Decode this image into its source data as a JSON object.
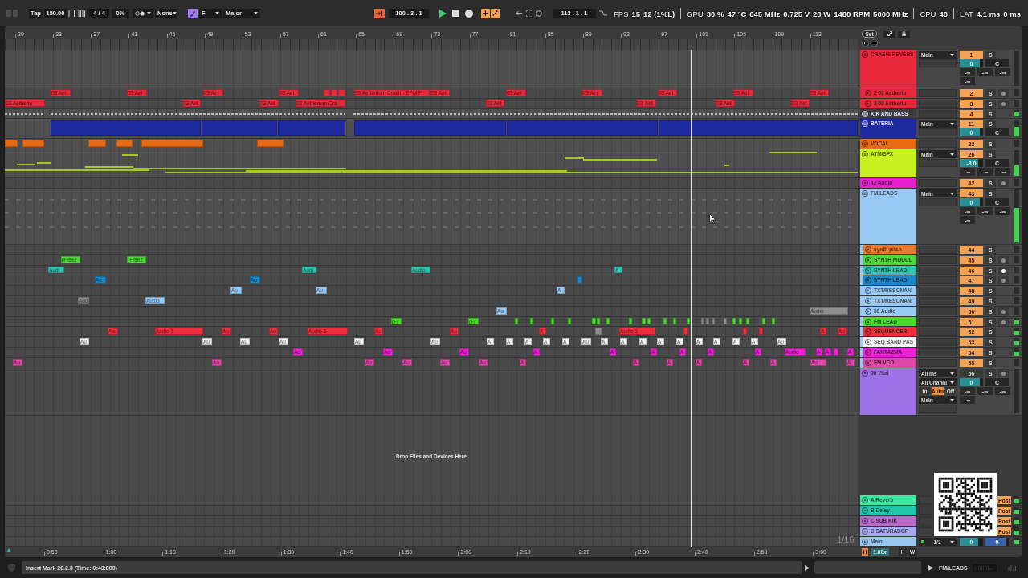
{
  "toolbar": {
    "tap": "Tap",
    "tempo": "150.00",
    "signature": "4 / 4",
    "groove": "0%",
    "quantize": "None",
    "scale_mode_on": true,
    "key": "F",
    "scale": "Major",
    "follow_on": true,
    "position": "100 . 3 . 1",
    "playing": true,
    "recording": false,
    "overdub_on": true,
    "automation_arm_on": true,
    "loop_length": "113 . 1 . 1"
  },
  "perf_overlay": [
    {
      "label": "FPS",
      "values": [
        "15",
        "12 (1%L)"
      ]
    },
    {
      "label": "GPU",
      "values": [
        "30 %",
        "47 °C",
        "645 MHz",
        "0.725 V",
        "28 W",
        "1480 RPM",
        "5000 MHz"
      ]
    },
    {
      "label": "CPU",
      "values": [
        "40"
      ]
    },
    {
      "label": "LAT",
      "values": [
        "4.1 ms",
        "0 ms"
      ]
    }
  ],
  "ruler": {
    "bars": [
      "29",
      "33",
      "37",
      "41",
      "45",
      "49",
      "53",
      "57",
      "61",
      "65",
      "69",
      "73",
      "77",
      "81",
      "85",
      "89",
      "93",
      "97",
      "101",
      "105",
      "109",
      "113"
    ],
    "set_button": "Set"
  },
  "tracks": [
    {
      "name": "CRASH/ REVERS",
      "kind": "group",
      "color": "#e8283c",
      "number": "1",
      "active": true,
      "solo": {
        "label": "S",
        "on": false
      },
      "io": "Main",
      "volume": {
        "value": "0",
        "level": 0.86
      },
      "pan": "C",
      "peaks": [
        "-∞",
        "-∞",
        "-∞",
        "-∞"
      ],
      "children": [
        {
          "name": "2 03 Aetheriu",
          "kind": "track",
          "expanded": false,
          "color": "#e8283c",
          "number": "2",
          "active": true,
          "solo": {
            "label": "S",
            "on": false
          },
          "arm": {
            "armed": false
          },
          "clips": [
            {
              "label": "03 Aet",
              "active": true
            },
            {
              "label": "03 Aet",
              "active": true
            },
            {
              "label": "03 Aet",
              "active": true
            },
            {
              "label": "03 Aet",
              "active": true
            },
            {
              "active": true
            },
            {
              "active": true
            },
            {
              "active": true
            },
            {
              "label": "03 Aetherium Crash - EPM F",
              "active": true
            },
            {
              "label": "03 Aet",
              "active": true
            },
            {
              "label": "03 Aet",
              "active": true
            },
            {
              "label": "03 Aet",
              "active": true
            },
            {
              "label": "03 Aet",
              "active": true
            },
            {
              "label": "03 Aet",
              "active": true
            },
            {
              "label": "03 Aet",
              "active": true
            }
          ]
        },
        {
          "name": "3 03 Aetheriu",
          "kind": "track",
          "expanded": false,
          "color": "#e8283c",
          "number": "3",
          "active": true,
          "solo": {
            "label": "S",
            "on": false
          },
          "arm": {
            "armed": false
          },
          "clips": [
            {
              "label": "03 Aetheriu",
              "active": true
            },
            {
              "label": "03 Aet",
              "active": true
            },
            {
              "label": "03 Aet",
              "active": true
            },
            {
              "label": "03 Aetherium Cra",
              "active": true
            },
            {
              "label": "03 Aet",
              "active": true
            },
            {
              "label": "03 Aet",
              "active": true
            },
            {
              "label": "03 Aet",
              "active": true
            },
            {
              "label": "03 Aet",
              "active": true
            }
          ]
        }
      ]
    },
    {
      "name": "KIK AND BASS",
      "kind": "group",
      "color": "#3d3d3d",
      "number": "4",
      "active": true,
      "solo": {
        "label": "S",
        "on": false
      },
      "signal": true
    },
    {
      "name": "BATERIA",
      "kind": "group",
      "color": "#1f2aa0",
      "number": "11",
      "active": true,
      "solo": {
        "label": "S",
        "on": false
      },
      "io": "Main",
      "volume": {
        "value": "0",
        "level": 0.86
      },
      "pan": "C",
      "meter": {
        "level": 0.55
      },
      "clips": [
        {
          "active": true
        },
        {
          "active": true
        },
        {
          "active": true
        },
        {
          "active": true
        },
        {
          "active": true
        },
        {
          "active": true
        }
      ]
    },
    {
      "name": "VOCAL",
      "kind": "group",
      "color": "#e86a14",
      "number": "23",
      "active": true,
      "solo": {
        "label": "S",
        "on": false
      },
      "clips": [
        {
          "active": true
        },
        {
          "active": true
        },
        {
          "active": true
        },
        {
          "active": true
        },
        {
          "active": true
        },
        {
          "active": true
        }
      ]
    },
    {
      "name": "ATM/SFX",
      "kind": "group",
      "color": "#c6f01e",
      "number": "26",
      "active": true,
      "solo": {
        "label": "S",
        "on": false
      },
      "io": "Main",
      "volume": {
        "value": "-3.0",
        "level": 0.8
      },
      "pan": "C",
      "peaks": [
        "-∞",
        "-∞",
        "-∞"
      ],
      "meter": {
        "level": 0.4
      }
    },
    {
      "name": "42 Audio",
      "kind": "track",
      "expanded": false,
      "color": "#e620cc",
      "number": "42",
      "active": true,
      "solo": {
        "label": "S",
        "on": false
      },
      "arm": {
        "armed": false
      }
    },
    {
      "name": "FM/LEADS",
      "kind": "group",
      "color": "#98c8f4",
      "number": "43",
      "active": true,
      "solo": {
        "label": "S",
        "on": false
      },
      "io": "Main",
      "volume": {
        "value": "0",
        "level": 0.86
      },
      "pan": "C",
      "peaks": [
        "-∞",
        "-∞",
        "-∞",
        "-∞"
      ],
      "meter": {
        "level": 0.65
      },
      "children": [
        {
          "name": "synth pitch",
          "kind": "track",
          "expanded": false,
          "color": "#ec7a2e",
          "number": "44",
          "active": true,
          "solo": {
            "label": "S",
            "on": false
          }
        },
        {
          "name": "SYNTH MODUL",
          "kind": "track",
          "expanded": false,
          "color": "#4ed63a",
          "number": "45",
          "active": true,
          "solo": {
            "label": "S",
            "on": false
          },
          "arm": {
            "armed": false
          },
          "clips": [
            {
              "label": "(Freez",
              "active": true
            },
            {
              "label": "(Freez",
              "active": true
            }
          ]
        },
        {
          "name": "SYNTH LEAD",
          "kind": "track",
          "expanded": false,
          "color": "#2cc6ae",
          "number": "46",
          "active": true,
          "solo": {
            "label": "S",
            "on": false
          },
          "arm": {
            "armed": true
          },
          "clips": [
            {
              "label": "Audi",
              "active": true
            },
            {
              "label": "Audi",
              "active": true
            },
            {
              "label": "Audio",
              "active": true
            },
            {
              "label": "A",
              "active": true
            }
          ]
        },
        {
          "name": "SYNTH LEAD",
          "kind": "track",
          "expanded": false,
          "color": "#1a88c8",
          "number": "47",
          "active": true,
          "solo": {
            "label": "S",
            "on": false
          },
          "arm": {
            "armed": false
          },
          "clips": [
            {
              "label": "Au",
              "active": true
            },
            {
              "label": "Au",
              "active": true
            },
            {
              "active": true
            }
          ]
        },
        {
          "name": "TXT/RESONAN",
          "kind": "track",
          "expanded": false,
          "color": "#98c8f4",
          "number": "48",
          "active": true,
          "solo": {
            "label": "S",
            "on": false
          },
          "clips": [
            {
              "label": "Au",
              "active": true
            },
            {
              "label": "Au",
              "active": true
            },
            {
              "label": "A",
              "active": true
            }
          ]
        },
        {
          "name": "TXT/RESONAN",
          "kind": "track",
          "expanded": false,
          "color": "#98c8f4",
          "number": "49",
          "active": true,
          "solo": {
            "label": "S",
            "on": false
          },
          "clips": [
            {
              "label": "Aud",
              "active": false
            },
            {
              "label": "Audio",
              "active": true
            }
          ]
        },
        {
          "name": "50 Audio",
          "kind": "track",
          "expanded": false,
          "color": "#98c8f4",
          "number": "50",
          "active": true,
          "solo": {
            "label": "S",
            "on": false
          },
          "arm": {
            "armed": false
          },
          "clips": [
            {
              "label": "Au",
              "active": true
            },
            {
              "label": "Audio",
              "active": false
            }
          ]
        },
        {
          "name": "FM LEAD",
          "kind": "track",
          "expanded": false,
          "color": "#46de26",
          "number": "51",
          "active": true,
          "solo": {
            "label": "S",
            "on": false
          },
          "arm": {
            "armed": false
          },
          "signal": true,
          "clips": [
            {
              "label": "(Fr",
              "active": true
            },
            {
              "label": "(Fr",
              "active": true
            },
            {
              "active": true
            },
            {
              "active": true
            },
            {
              "active": true
            },
            {
              "active": true
            },
            {
              "active": true
            },
            {
              "active": true
            },
            {
              "active": true
            },
            {
              "active": true
            },
            {
              "active": true
            },
            {
              "active": true
            },
            {
              "active": true
            },
            {
              "active": true
            },
            {
              "active": true
            },
            {
              "active": false
            },
            {
              "active": false
            },
            {
              "active": false
            },
            {
              "active": false
            },
            {
              "active": true
            },
            {
              "active": true
            },
            {
              "active": true
            },
            {
              "active": true
            },
            {
              "active": true
            }
          ]
        },
        {
          "name": "SEQUENCER",
          "kind": "track",
          "expanded": false,
          "color": "#ee2e3c",
          "number": "52",
          "active": true,
          "solo": {
            "label": "S",
            "on": false
          },
          "signal": true,
          "clips": [
            {
              "label": "Au",
              "active": true
            },
            {
              "label": "Audio 3",
              "active": true
            },
            {
              "label": "Au",
              "active": true
            },
            {
              "label": "Au",
              "active": true
            },
            {
              "label": "Audio 3",
              "active": true
            },
            {
              "label": "Au",
              "active": true
            },
            {
              "label": "Au",
              "active": true
            },
            {
              "label": "A",
              "active": true
            },
            {
              "active": false
            },
            {
              "label": "Audio 3",
              "active": true
            },
            {
              "active": true
            },
            {
              "active": true
            },
            {
              "active": true
            },
            {
              "label": "A",
              "active": true
            },
            {
              "label": "Au",
              "active": true
            }
          ]
        },
        {
          "name": "SEQ BAND PAS",
          "kind": "track",
          "expanded": false,
          "color": "#f4f4f4",
          "number": "53",
          "active": true,
          "solo": {
            "label": "S",
            "on": false
          },
          "signal": true,
          "clips": [
            {
              "label": "Au",
              "active": true
            },
            {
              "label": "Au",
              "active": true
            },
            {
              "label": "Au",
              "active": true
            },
            {
              "label": "Au",
              "active": true
            },
            {
              "label": "Au",
              "active": true
            },
            {
              "label": "Au",
              "active": true
            },
            {
              "label": "A",
              "active": true
            },
            {
              "label": "A",
              "active": true
            },
            {
              "label": "A",
              "active": true
            },
            {
              "label": "A",
              "active": true
            },
            {
              "label": "A",
              "active": true
            },
            {
              "label": "Au",
              "active": true
            },
            {
              "label": "A",
              "active": true
            },
            {
              "label": "A",
              "active": true
            },
            {
              "label": "A",
              "active": true
            },
            {
              "label": "A",
              "active": true
            },
            {
              "label": "A",
              "active": true
            },
            {
              "label": "A",
              "active": true
            },
            {
              "label": "A",
              "active": true
            },
            {
              "label": "A",
              "active": true
            },
            {
              "label": "A",
              "active": true
            },
            {
              "label": "Au",
              "active": true
            }
          ]
        },
        {
          "name": "FANTAZMA",
          "kind": "track",
          "expanded": false,
          "color": "#ee22d4",
          "number": "54",
          "active": true,
          "solo": {
            "label": "S",
            "on": false
          },
          "signal": true,
          "clips": [
            {
              "label": "Au",
              "active": true
            },
            {
              "label": "Au",
              "active": true
            },
            {
              "label": "Au",
              "active": true
            },
            {
              "label": "A",
              "active": true
            },
            {
              "label": "A",
              "active": true
            },
            {
              "label": "A",
              "active": true
            },
            {
              "label": "A",
              "active": true
            },
            {
              "label": "A",
              "active": true
            },
            {
              "label": "A",
              "active": true
            },
            {
              "label": "Audio",
              "active": true
            },
            {
              "label": "A",
              "active": true
            },
            {
              "label": "A",
              "active": true
            },
            {
              "active": true
            },
            {
              "label": "A",
              "active": true
            }
          ]
        },
        {
          "name": "FM VCO",
          "kind": "track",
          "expanded": false,
          "color": "#e048a8",
          "number": "55",
          "active": true,
          "solo": {
            "label": "S",
            "on": false
          },
          "clips": [
            {
              "label": "Au",
              "active": true
            },
            {
              "label": "Au",
              "active": true
            },
            {
              "label": "Au",
              "active": true
            },
            {
              "label": "Au",
              "active": true
            },
            {
              "label": "Au",
              "active": true
            },
            {
              "label": "Au",
              "active": true
            },
            {
              "label": "A",
              "active": true
            },
            {
              "label": "A",
              "active": true
            },
            {
              "label": "A",
              "active": true
            },
            {
              "label": "A",
              "active": true
            },
            {
              "label": "A",
              "active": true
            },
            {
              "label": "A",
              "active": true
            },
            {
              "label": "Au",
              "active": true
            },
            {
              "label": "A",
              "active": true
            }
          ]
        }
      ]
    },
    {
      "name": "56 Vital",
      "kind": "track",
      "expanded": true,
      "color": "#9c72e4",
      "number": "56",
      "active": false,
      "solo": {
        "label": "S",
        "on": false
      },
      "arm": {
        "armed": false
      },
      "inputs": [
        "All Ins",
        "All Channi"
      ],
      "monitor": [
        {
          "label": "In",
          "selected": false
        },
        {
          "label": "Auto",
          "selected": true
        },
        {
          "label": "Off",
          "selected": false
        }
      ],
      "io": "Main",
      "volume": {
        "value": "0",
        "level": 0.86
      },
      "pan": "C",
      "peaks": [
        "-∞",
        "-∞",
        "-∞",
        "-∞"
      ]
    }
  ],
  "drop_hint": "Drop Files and Devices Here",
  "returns": [
    {
      "name": "A Reverb",
      "color": "#3ee8a0",
      "expanded": false,
      "send_mode": "Post",
      "signal": true
    },
    {
      "name": "B Delay",
      "color": "#1ec8aa",
      "expanded": false,
      "send_mode": "Post",
      "signal": true
    },
    {
      "name": "C SUB KIK",
      "color": "#b86cc8",
      "expanded": false,
      "send_mode": "Post",
      "signal": true
    },
    {
      "name": "D SATURADOR",
      "color": "#a6a8f2",
      "expanded": false,
      "send_mode": "Post",
      "signal": true
    },
    {
      "name": "Main",
      "color": "#98c8f2",
      "expanded": false,
      "io": "1/2",
      "volume": {
        "value": "0",
        "level": 0.8
      },
      "cue": {
        "value": "0",
        "level": 0.85
      },
      "signal": true
    }
  ],
  "grid_label": "1/16",
  "time_ruler": {
    "times": [
      "0:50",
      "1:00",
      "1:10",
      "1:20",
      "1:30",
      "1:40",
      "1:50",
      "2:00",
      "2:10",
      "2:20",
      "2:30",
      "2:40",
      "2:50",
      "3:00"
    ],
    "zoom": "1.00x",
    "buttons": [
      "H",
      "W"
    ]
  },
  "status_bar": {
    "message": "Insert Mark 28.2.3 (Time: 0:43:800)",
    "selected_track": "FM/LEADS"
  }
}
